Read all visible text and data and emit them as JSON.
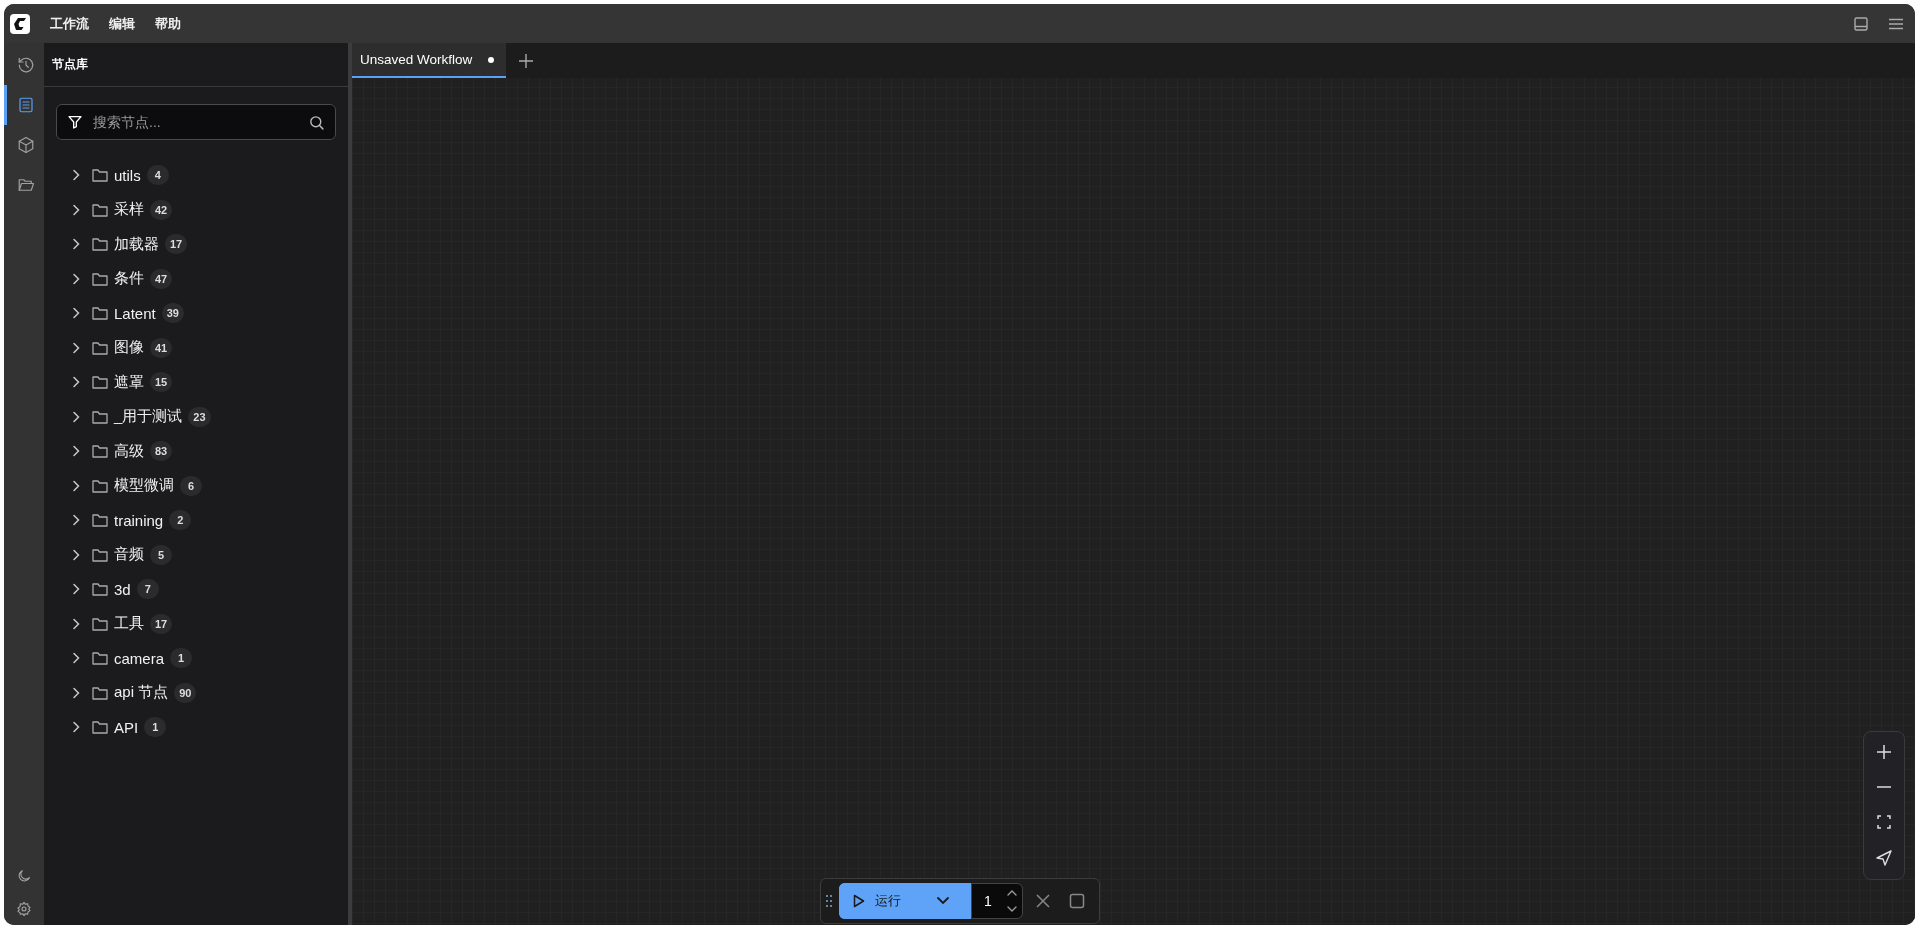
{
  "menu": [
    {
      "label": "工作流"
    },
    {
      "label": "编辑"
    },
    {
      "label": "帮助"
    }
  ],
  "side_rail": [
    {
      "kind": "history",
      "selected": false
    },
    {
      "kind": "library",
      "selected": true
    },
    {
      "kind": "models",
      "selected": false
    },
    {
      "kind": "workflows",
      "selected": false
    }
  ],
  "panel": {
    "title": "节点库",
    "search": {
      "placeholder": "搜索节点..."
    },
    "categories": [
      {
        "name": "utils",
        "count": "4",
        "expanded": false
      },
      {
        "name": "采样",
        "count": "42",
        "expanded": false
      },
      {
        "name": "加载器",
        "count": "17",
        "expanded": false
      },
      {
        "name": "条件",
        "count": "47",
        "expanded": false
      },
      {
        "name": "Latent",
        "count": "39",
        "expanded": false
      },
      {
        "name": "图像",
        "count": "41",
        "expanded": false
      },
      {
        "name": "遮罩",
        "count": "15",
        "expanded": false
      },
      {
        "name": "_用于测试",
        "count": "23",
        "expanded": false
      },
      {
        "name": "高级",
        "count": "83",
        "expanded": false
      },
      {
        "name": "模型微调",
        "count": "6",
        "expanded": false
      },
      {
        "name": "training",
        "count": "2",
        "expanded": false
      },
      {
        "name": "音频",
        "count": "5",
        "expanded": false
      },
      {
        "name": "3d",
        "count": "7",
        "expanded": false
      },
      {
        "name": "工具",
        "count": "17",
        "expanded": false
      },
      {
        "name": "camera",
        "count": "1",
        "expanded": false
      },
      {
        "name": "api 节点",
        "count": "90",
        "expanded": false
      },
      {
        "name": "API",
        "count": "1",
        "expanded": false
      }
    ]
  },
  "tabs": [
    {
      "label": "Unsaved Workflow",
      "selected": true,
      "modified": true
    }
  ],
  "run_toolbar": {
    "run_label": "运行",
    "batch_count": "1"
  }
}
